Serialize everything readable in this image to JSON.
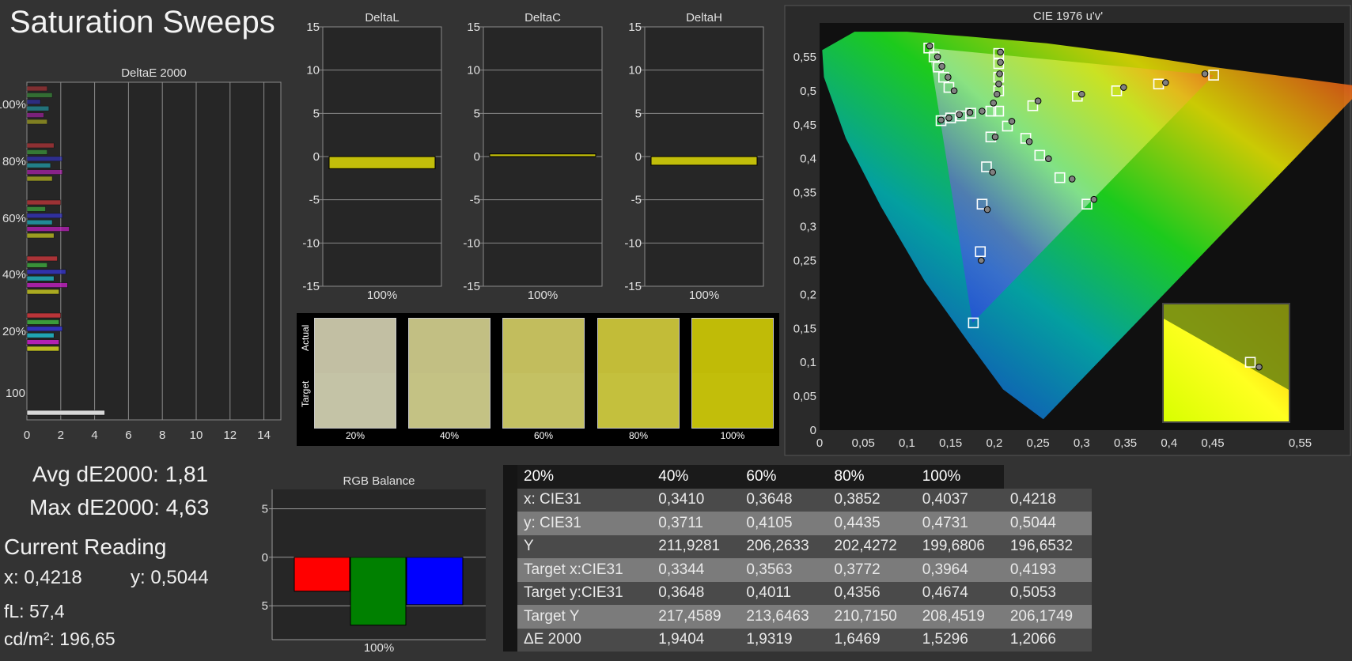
{
  "page_title": "Saturation Sweeps",
  "summary": {
    "avg_label": "Avg dE2000: 1,81",
    "max_label": "Max dE2000: 4,63",
    "current_reading_title": "Current Reading",
    "x_reading": "x: 0,4218",
    "y_reading": "y: 0,5044",
    "fl_reading": "fL: 57,4",
    "cdm2_reading": "cd/m²: 196,65"
  },
  "swatches": {
    "actual_label": "Actual",
    "target_label": "Target",
    "items": [
      {
        "label": "20%",
        "actual": "#c2bfa3",
        "target": "#c4c3a6"
      },
      {
        "label": "40%",
        "actual": "#c2bf83",
        "target": "#c4c284"
      },
      {
        "label": "60%",
        "actual": "#c2bd5d",
        "target": "#c4c163"
      },
      {
        "label": "80%",
        "actual": "#c2bc38",
        "target": "#c4c03d"
      },
      {
        "label": "100%",
        "actual": "#c0bb07",
        "target": "#c2be0a"
      }
    ]
  },
  "table": {
    "headers": [
      "",
      "20%",
      "40%",
      "60%",
      "80%",
      "100%"
    ],
    "rows": [
      [
        "x: CIE31",
        "0,3410",
        "0,3648",
        "0,3852",
        "0,4037",
        "0,4218"
      ],
      [
        "y: CIE31",
        "0,3711",
        "0,4105",
        "0,4435",
        "0,4731",
        "0,5044"
      ],
      [
        "Y",
        "211,9281",
        "206,2633",
        "202,4272",
        "199,6806",
        "196,6532"
      ],
      [
        "Target x:CIE31",
        "0,3344",
        "0,3563",
        "0,3772",
        "0,3964",
        "0,4193"
      ],
      [
        "Target y:CIE31",
        "0,3648",
        "0,4011",
        "0,4356",
        "0,4674",
        "0,5053"
      ],
      [
        "Target Y",
        "217,4589",
        "213,6463",
        "210,7150",
        "208,4519",
        "206,1749"
      ],
      [
        "ΔE 2000",
        "1,9404",
        "1,9319",
        "1,6469",
        "1,5296",
        "1,2066"
      ]
    ]
  },
  "chart_data": [
    {
      "id": "deltae",
      "type": "bar",
      "orientation": "horizontal",
      "title": "DeltaE 2000",
      "xlim": [
        0,
        15
      ],
      "xticks": [
        0,
        2,
        4,
        6,
        8,
        10,
        12,
        14
      ],
      "group_labels": [
        "100%",
        "80%",
        "60%",
        "40%",
        "20%",
        "100"
      ],
      "series_colors": [
        "#c8373b",
        "#3ea83e",
        "#3434c8",
        "#20b0c0",
        "#c020c0",
        "#c8c820"
      ],
      "groups": [
        {
          "label": "100%",
          "values": [
            1.2,
            1.5,
            0.8,
            1.3,
            1.0,
            1.2
          ]
        },
        {
          "label": "80%",
          "values": [
            1.6,
            1.2,
            2.1,
            1.4,
            2.1,
            1.5
          ]
        },
        {
          "label": "60%",
          "values": [
            2.0,
            1.1,
            2.1,
            1.5,
            2.5,
            1.6
          ]
        },
        {
          "label": "40%",
          "values": [
            1.8,
            1.2,
            2.3,
            1.6,
            2.4,
            1.9
          ]
        },
        {
          "label": "20%",
          "values": [
            2.0,
            1.9,
            2.1,
            1.6,
            1.9,
            1.9
          ]
        },
        {
          "label": "100",
          "values": [
            4.6
          ]
        }
      ],
      "grid": true
    },
    {
      "id": "deltaL",
      "type": "bar",
      "title": "DeltaL",
      "categories": [
        "100%"
      ],
      "values": [
        -1.4
      ],
      "ylim": [
        -15,
        15
      ],
      "yticks": [
        15,
        10,
        5,
        0,
        -5,
        -10,
        -15
      ],
      "color": "#c2be0a"
    },
    {
      "id": "deltaC",
      "type": "bar",
      "title": "DeltaC",
      "categories": [
        "100%"
      ],
      "values": [
        0.3
      ],
      "ylim": [
        -15,
        15
      ],
      "yticks": [
        15,
        10,
        5,
        0,
        -5,
        -10,
        -15
      ],
      "color": "#c2be0a"
    },
    {
      "id": "deltaH",
      "type": "bar",
      "title": "DeltaH",
      "categories": [
        "100%"
      ],
      "values": [
        -1.0
      ],
      "ylim": [
        -15,
        15
      ],
      "yticks": [
        15,
        10,
        5,
        0,
        -5,
        -10,
        -15
      ],
      "color": "#c2be0a"
    },
    {
      "id": "rgb",
      "type": "bar",
      "title": "RGB Balance",
      "categories": [
        "100%"
      ],
      "series": [
        {
          "values": [
            -3.5
          ],
          "color": "#ff0000"
        },
        {
          "values": [
            -7.0
          ],
          "color": "#008000"
        },
        {
          "values": [
            -4.9
          ],
          "color": "#0000ff"
        }
      ],
      "ylim": [
        -8.5,
        7
      ],
      "yticks": [
        5,
        0,
        -5
      ]
    },
    {
      "id": "cie",
      "type": "scatter",
      "title": "CIE 1976 u'v'",
      "xlim": [
        0,
        0.6
      ],
      "ylim": [
        0,
        0.6
      ],
      "xticks": [
        "0",
        "0,05",
        "0,1",
        "0,15",
        "0,2",
        "0,25",
        "0,3",
        "0,35",
        "0,4",
        "0,45",
        "0,55"
      ],
      "xtick_values": [
        0,
        0.05,
        0.1,
        0.15,
        0.2,
        0.25,
        0.3,
        0.35,
        0.4,
        0.45,
        0.55
      ],
      "yticks": [
        "0",
        "0,05",
        "0,1",
        "0,15",
        "0,2",
        "0,25",
        "0,3",
        "0,35",
        "0,4",
        "0,45",
        "0,5",
        "0,55"
      ],
      "ytick_values": [
        0,
        0.05,
        0.1,
        0.15,
        0.2,
        0.25,
        0.3,
        0.35,
        0.4,
        0.45,
        0.5,
        0.55
      ],
      "gamut_triangle": [
        [
          0.451,
          0.523
        ],
        [
          0.125,
          0.563
        ],
        [
          0.175,
          0.158
        ]
      ],
      "targets": [
        [
          0.125,
          0.563
        ],
        [
          0.131,
          0.55
        ],
        [
          0.136,
          0.535
        ],
        [
          0.142,
          0.52
        ],
        [
          0.148,
          0.505
        ],
        [
          0.139,
          0.456
        ],
        [
          0.15,
          0.46
        ],
        [
          0.162,
          0.463
        ],
        [
          0.173,
          0.467
        ],
        [
          0.196,
          0.47
        ],
        [
          0.205,
          0.47
        ],
        [
          0.205,
          0.5
        ],
        [
          0.205,
          0.52
        ],
        [
          0.205,
          0.54
        ],
        [
          0.205,
          0.555
        ],
        [
          0.215,
          0.448
        ],
        [
          0.236,
          0.43
        ],
        [
          0.252,
          0.405
        ],
        [
          0.275,
          0.372
        ],
        [
          0.306,
          0.333
        ],
        [
          0.244,
          0.478
        ],
        [
          0.295,
          0.492
        ],
        [
          0.34,
          0.5
        ],
        [
          0.388,
          0.51
        ],
        [
          0.451,
          0.523
        ],
        [
          0.196,
          0.432
        ],
        [
          0.191,
          0.388
        ],
        [
          0.186,
          0.333
        ],
        [
          0.184,
          0.263
        ],
        [
          0.176,
          0.158
        ]
      ],
      "measured": [
        [
          0.126,
          0.566
        ],
        [
          0.135,
          0.55
        ],
        [
          0.14,
          0.536
        ],
        [
          0.147,
          0.52
        ],
        [
          0.154,
          0.5
        ],
        [
          0.139,
          0.457
        ],
        [
          0.148,
          0.46
        ],
        [
          0.16,
          0.465
        ],
        [
          0.172,
          0.468
        ],
        [
          0.186,
          0.47
        ],
        [
          0.199,
          0.482
        ],
        [
          0.203,
          0.495
        ],
        [
          0.205,
          0.51
        ],
        [
          0.206,
          0.525
        ],
        [
          0.207,
          0.542
        ],
        [
          0.207,
          0.557
        ],
        [
          0.22,
          0.455
        ],
        [
          0.24,
          0.425
        ],
        [
          0.262,
          0.4
        ],
        [
          0.289,
          0.37
        ],
        [
          0.314,
          0.34
        ],
        [
          0.25,
          0.485
        ],
        [
          0.3,
          0.495
        ],
        [
          0.348,
          0.505
        ],
        [
          0.396,
          0.512
        ],
        [
          0.441,
          0.525
        ],
        [
          0.201,
          0.432
        ],
        [
          0.198,
          0.38
        ],
        [
          0.192,
          0.325
        ],
        [
          0.185,
          0.25
        ]
      ],
      "inset_target": [
        0.493,
        0.1
      ],
      "inset_measured": [
        0.503,
        0.093
      ]
    }
  ]
}
